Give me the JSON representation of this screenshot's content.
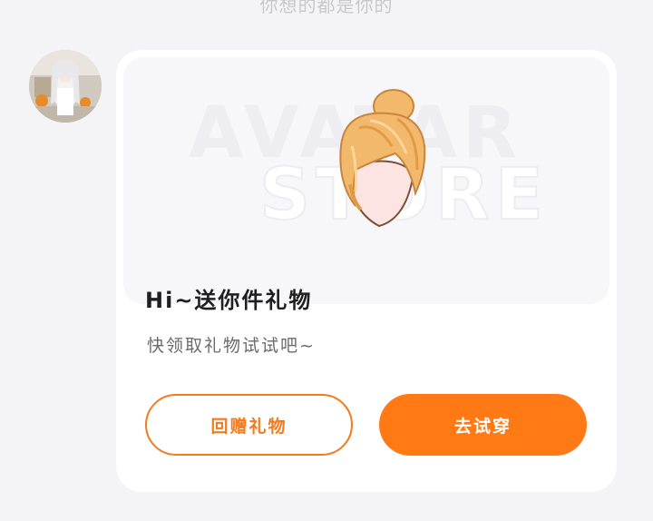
{
  "top_hint": "你想的都是你的",
  "gift": {
    "hero_brand_line1": "AVATAR",
    "hero_brand_line2": "STORE",
    "title": "Hi~送你件礼物",
    "subtitle": "快领取礼物试试吧~"
  },
  "buttons": {
    "return_gift": "回赠礼物",
    "try_on": "去试穿"
  },
  "colors": {
    "accent": "#ff7a14",
    "card": "#ffffff",
    "background": "#f4f4f6",
    "hair": "#f2b86b"
  },
  "icons": {
    "avatar": "user-avatar-image",
    "item": "hair-item-image"
  }
}
